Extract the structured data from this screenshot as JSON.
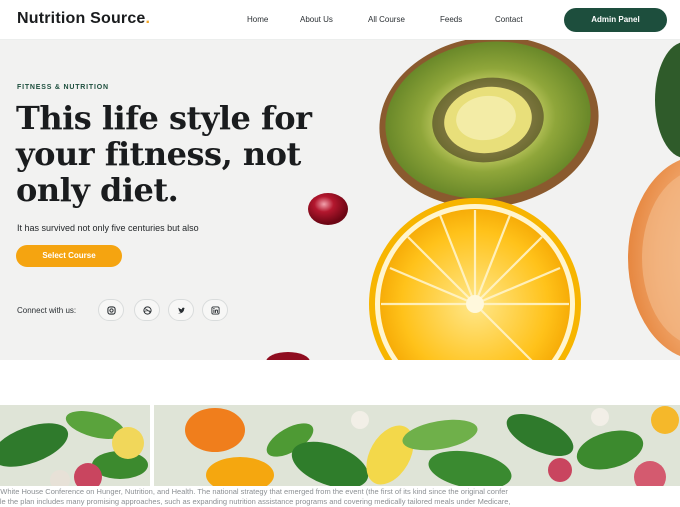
{
  "header": {
    "logo_text": "Nutrition Source",
    "logo_dot": ".",
    "nav": [
      "Home",
      "About Us",
      "All Course",
      "Feeds",
      "Contact"
    ],
    "admin_button": "Admin Panel"
  },
  "hero": {
    "eyebrow": "FITNESS & NUTRITION",
    "headline": "This life style for your fitness, not only diet.",
    "subtext": "It has survived not only five centuries but also",
    "cta": "Select Course",
    "connect_label": "Connect with us:",
    "social_icons": [
      "instagram-icon",
      "dribbble-icon",
      "twitter-icon",
      "linkedin-icon"
    ]
  },
  "article": {
    "caption_line1": "e White House Conference on Hunger, Nutrition, and Health. The national strategy that emerged from the event (the first of its kind since the original confer",
    "caption_line2": "hile the plan includes many promising approaches, such as expanding nutrition assistance programs and covering medically tailored meals under Medicare,"
  },
  "colors": {
    "brand_green": "#1d4e3d",
    "accent_orange": "#f5a410",
    "logo_dot": "#f5a623"
  }
}
